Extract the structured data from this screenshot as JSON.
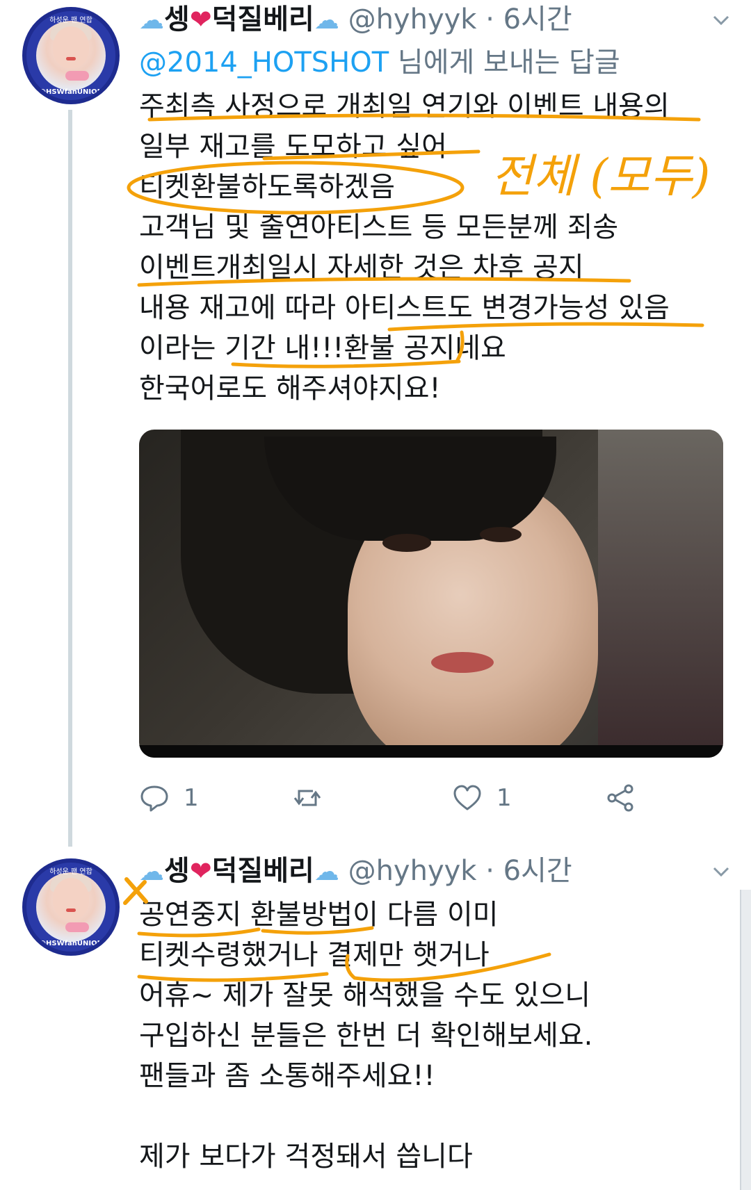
{
  "tweets": [
    {
      "display_name": "셍",
      "display_name_2": "덕질베리",
      "handle": "@hyhyyk",
      "time": "· 6시간",
      "reply_mention": "@2014_HOTSHOT",
      "reply_suffix": " 님에게 보내는 답글",
      "avatar_top_text": "하성운 팬 연합",
      "avatar_bottom_text": "@HSWfanUNION",
      "lines": [
        "주최측 사정으로 개최일 연기와 이벤트 내용의",
        "일부  재고를 도모하고 싶어",
        "티켓환불하도록하겠음",
        "고객님 및 출연아티스트 등 모든분께 죄송",
        "이벤트개최일시 자세한 것은 차후 공지",
        "내용 재고에 따라 아티스트도 변경가능성 있음",
        "이라는 기간 내!!!환불 공지네요",
        "한국어로도 해주셔야지요!"
      ],
      "handwriting_note": "전체 (모두)",
      "actions": {
        "reply_count": "1",
        "retweet_count": "",
        "like_count": "1"
      }
    },
    {
      "display_name": "셍",
      "display_name_2": "덕질베리",
      "handle": "@hyhyyk",
      "time": "· 6시간",
      "avatar_top_text": "하성운 팬 연합",
      "avatar_bottom_text": "@HSWfanUNION",
      "lines": [
        "공연중지 환불방법이 다름 이미",
        "티켓수령했거나 결제만 햇거나",
        "어휴~ 제가 잘못 해석했을 수도 있으니",
        "구입하신 분들은 한번 더 확인해보세요.",
        "팬들과 좀  소통해주세요!!",
        "",
        "제가 보다가 걱정돼서 씁니다"
      ]
    }
  ],
  "icons": {
    "cloud": "☁",
    "heart": "❤",
    "chevron": "chevron-down-icon"
  },
  "colors": {
    "accent": "#1da1f2",
    "muted": "#657786",
    "annotation": "#f4a10a",
    "thread_line": "#cfd9de"
  }
}
